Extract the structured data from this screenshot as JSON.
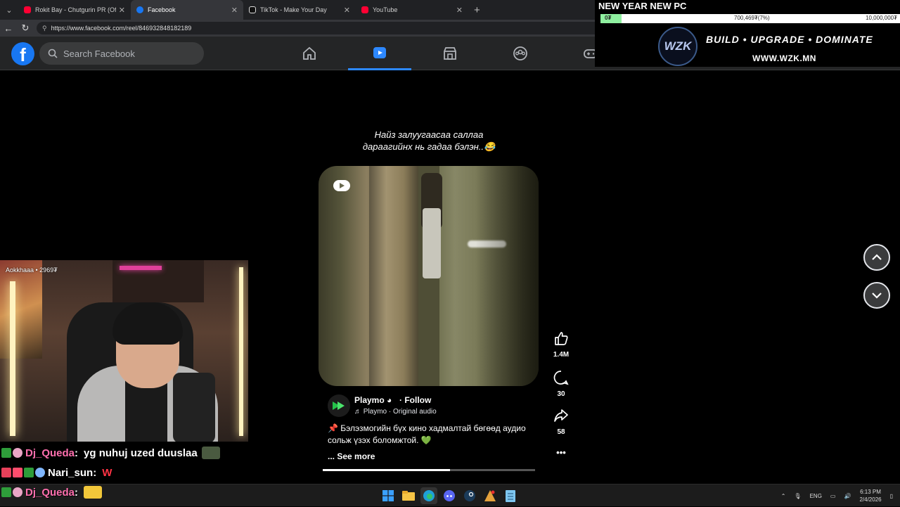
{
  "browser": {
    "tabs": [
      {
        "title": "Rokit Bay - Chutgurin PR (Official",
        "color": "#ff0033"
      },
      {
        "title": "Facebook",
        "color": "#1877f2"
      },
      {
        "title": "TikTok - Make Your Day",
        "color": "#ffffff"
      },
      {
        "title": "YouTube",
        "color": "#ff0033"
      }
    ],
    "url": "https://www.facebook.com/reel/846932848182189"
  },
  "facebook": {
    "logo": "f",
    "search_placeholder": "Search Facebook",
    "nav_icons": [
      "home-icon",
      "reels-icon",
      "marketplace-icon",
      "groups-icon",
      "gaming-icon"
    ],
    "active_nav": "reels-icon",
    "accent": "#2d88ff"
  },
  "promo": {
    "title": "NEW YEAR NEW PC",
    "bar_left": "0₮",
    "bar_middle": "700,469₮(7%)",
    "bar_right": "10,000,000₮",
    "progress": 0.07,
    "logo": "WZK",
    "tagline": "BUILD • UPGRADE • DOMINATE",
    "site": "WWW.WZK.MN"
  },
  "reel": {
    "caption_line1": "Найз залуугаасаа саллаа",
    "caption_line2": "дараагийнх нь гадаа бэлэн..😂",
    "author": "Playmo",
    "follow": "· Follow",
    "audio": "♬ Playmo · Original audio",
    "description": "📌 Бэлэзмогийн бүх кино хадмалтай бөгөөд аудио сольж үзэх боломжтой. 💚",
    "see_more": "... See more",
    "progress": 0.6,
    "likes": "1.4M",
    "comments": "30",
    "shares": "58",
    "more": "•••"
  },
  "stream": {
    "viewer": "Aokkhaaa • 2969₮",
    "chat": [
      {
        "user": "Dj_Queda",
        "message": "yg nuhuj uzed duuslaa",
        "red": false
      },
      {
        "user": "Nari_sun",
        "message": "W",
        "red": true
      },
      {
        "user": "Dj_Queda",
        "message": "",
        "red": false
      }
    ]
  },
  "taskbar": {
    "lang": "ENG",
    "time": "6:13 PM",
    "date": "2/4/2026"
  }
}
